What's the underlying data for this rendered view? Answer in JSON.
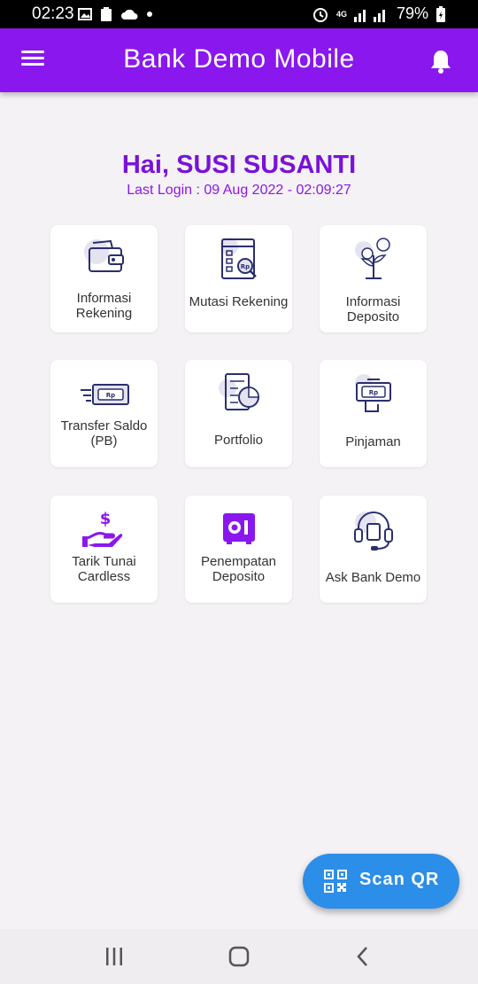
{
  "status_bar": {
    "time": "02:23",
    "network": "4G",
    "battery": "79%"
  },
  "app_bar": {
    "title": "Bank Demo Mobile"
  },
  "greeting": {
    "hello": "Hai, SUSI SUSANTI",
    "last_login": "Last Login : 09 Aug 2022 - 02:09:27"
  },
  "menu": [
    {
      "label": "Informasi Rekening",
      "icon": "wallet-icon"
    },
    {
      "label": "Mutasi Rekening",
      "icon": "statement-icon"
    },
    {
      "label": "Informasi Deposito",
      "icon": "money-plant-icon"
    },
    {
      "label": "Transfer Saldo (PB)",
      "icon": "money-transfer-icon"
    },
    {
      "label": "Portfolio",
      "icon": "portfolio-icon"
    },
    {
      "label": "Pinjaman",
      "icon": "loan-icon"
    },
    {
      "label": "Tarik Tunai Cardless",
      "icon": "cash-hand-icon"
    },
    {
      "label": "Penempatan Deposito",
      "icon": "safe-icon"
    },
    {
      "label": "Ask Bank Demo",
      "icon": "headset-icon"
    }
  ],
  "fab": {
    "label": "Scan QR",
    "icon": "qr-code-icon"
  },
  "colors": {
    "primary": "#8a17ee",
    "fab": "#2b8ee8",
    "background": "#f4f2f4"
  }
}
